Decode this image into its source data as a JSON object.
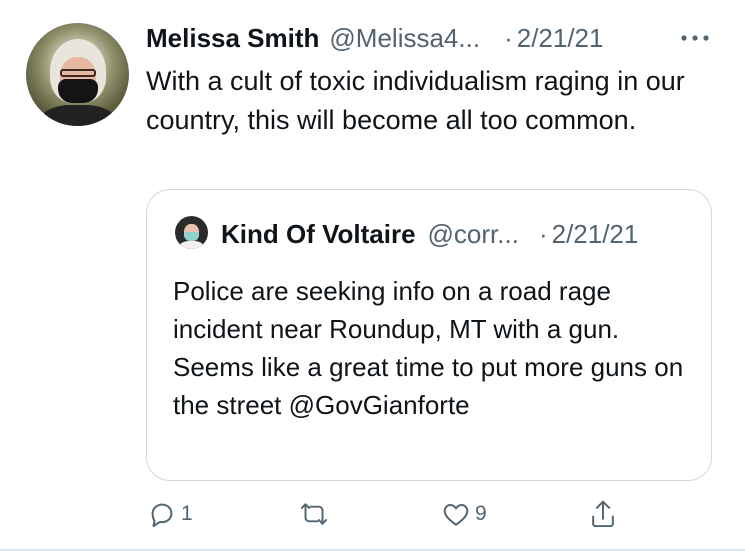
{
  "tweet": {
    "author_name": "Melissa Smith",
    "author_handle": "@Melissa4...",
    "separator": "·",
    "date": "2/21/21",
    "text": "With a cult of toxic individualism raging in our country, this will become all too common."
  },
  "quoted_tweet": {
    "author_name": "Kind Of Voltaire",
    "author_handle": "@corr...",
    "separator": "·",
    "date": "2/21/21",
    "text": "Police are seeking info on a road rage incident near Roundup, MT with a gun. Seems like a great time to put more guns on the street @GovGianforte"
  },
  "actions": {
    "reply_count": "1",
    "like_count": "9"
  },
  "icons": {
    "more": "more-horizontal-icon",
    "reply": "reply-bubble-icon",
    "retweet": "retweet-icon",
    "like": "heart-icon",
    "share": "share-upload-icon"
  },
  "colors": {
    "text_primary": "#0f1419",
    "text_secondary": "#536471",
    "border": "#cfd9de"
  }
}
